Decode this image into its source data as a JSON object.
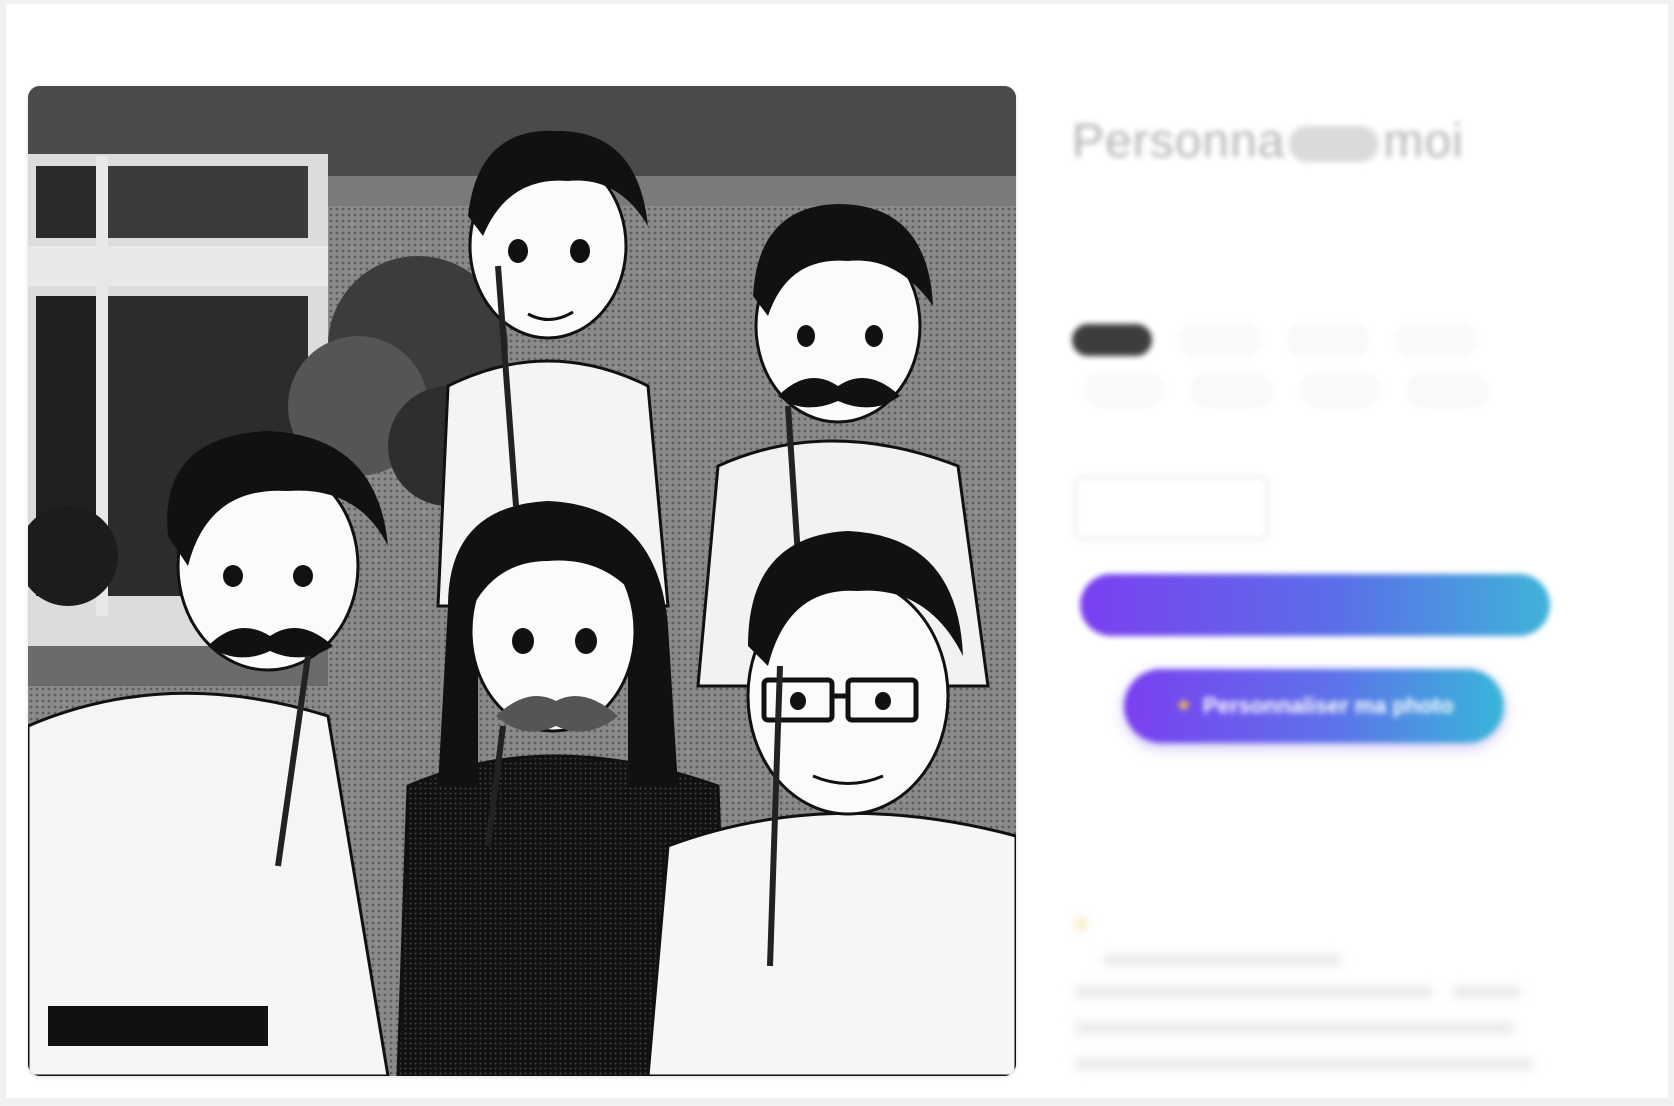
{
  "product": {
    "brand": "",
    "title_left": "Personna",
    "title_right": "moi",
    "price": "",
    "tax_note": ""
  },
  "size": {
    "label": "",
    "options": [
      "",
      "",
      "",
      "",
      "",
      "",
      "",
      ""
    ],
    "selected_index": 0
  },
  "quantity": {
    "label": "",
    "minus": "",
    "value": "",
    "plus": ""
  },
  "actions": {
    "add_to_cart": "",
    "personalize": "Personnaliser ma photo"
  },
  "description": {
    "text_before": "",
    "bold1": "",
    "text_middle": "",
    "bold2": ""
  },
  "bullet": {
    "text": ""
  },
  "icons": {
    "personalize": "sparkle-icon",
    "bullet": "star-icon"
  },
  "colors": {
    "gradient_start": "#7b3ff0",
    "gradient_mid": "#5a6fe8",
    "gradient_end": "#3fb3d9",
    "selected_size": "#3d3d3d"
  }
}
